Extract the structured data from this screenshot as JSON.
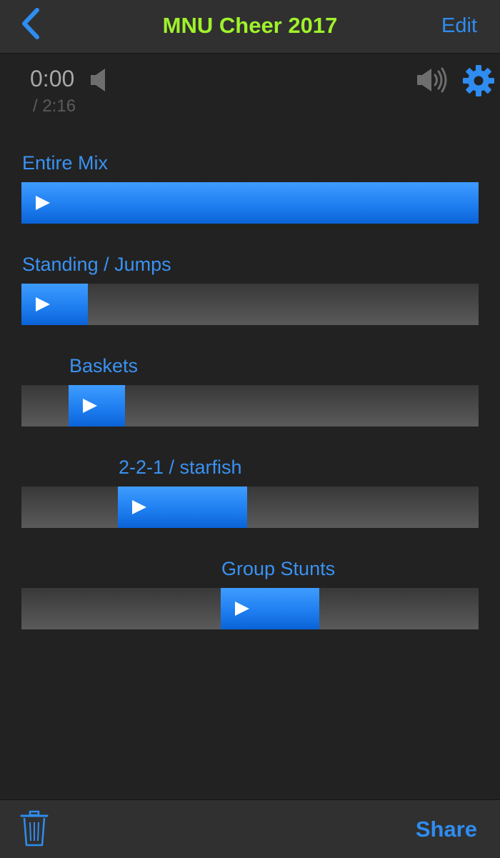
{
  "nav": {
    "title": "MNU Cheer 2017",
    "edit_label": "Edit",
    "back_icon": "chevron-left-icon"
  },
  "player": {
    "current_time": "0:00",
    "total_time": "/ 2:16",
    "volume_min_icon": "speaker-low-icon",
    "volume_max_icon": "speaker-high-icon",
    "settings_icon": "gear-icon"
  },
  "segments": [
    {
      "label": "Entire Mix",
      "start": "0:00",
      "end": "2:16"
    },
    {
      "label": "Standing / Jumps",
      "start": "0:00",
      "end": "0:20"
    },
    {
      "label": "Baskets",
      "start": "0:14",
      "end": "0:31"
    },
    {
      "label": "2-2-1 / starfish",
      "start": "0:29",
      "end": "1:08"
    },
    {
      "label": "Group Stunts",
      "start": "0:59",
      "end": "1:29"
    }
  ],
  "toolbar": {
    "trash_icon": "trash-icon",
    "share_label": "Share"
  },
  "colors": {
    "accent": "#2f8cf0",
    "title": "#9ff22b",
    "background": "#222222",
    "bar": "#303030"
  }
}
